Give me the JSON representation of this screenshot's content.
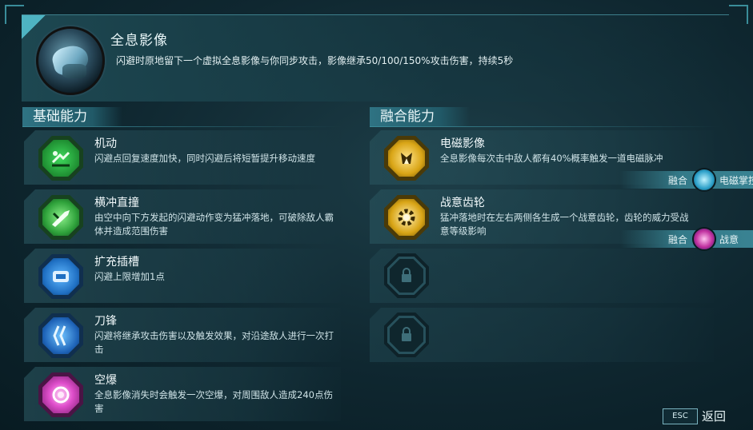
{
  "header": {
    "title": "全息影像",
    "description": "闪避时原地留下一个虚拟全息影像与你同步攻击，影像继承50/100/150%攻击伤害，持续5秒",
    "icon": "hologram-hand-icon"
  },
  "basic": {
    "heading": "基础能力",
    "items": [
      {
        "title": "机动",
        "desc": "闪避点回复速度加快，同时闪避后将短暂提升移动速度",
        "icon": "mobility-icon",
        "color": "#3fcf5a"
      },
      {
        "title": "横冲直撞",
        "desc": "由空中向下方发起的闪避动作变为猛冲落地，可破除敌人霸体并造成范围伤害",
        "icon": "dash-strike-icon",
        "color": "#3fcf5a"
      },
      {
        "title": "扩充插槽",
        "desc": "闪避上限增加1点",
        "icon": "slot-expand-icon",
        "color": "#2f8fe0"
      },
      {
        "title": "刀锋",
        "desc": "闪避将继承攻击伤害以及触发效果，对沿途敌人进行一次打击",
        "icon": "blade-icon",
        "color": "#2f8fe0"
      },
      {
        "title": "空爆",
        "desc": "全息影像消失时会触发一次空爆，对周围敌人造成240点伤害",
        "icon": "air-burst-icon",
        "color": "#e043c8"
      }
    ]
  },
  "fusion": {
    "heading": "融合能力",
    "items": [
      {
        "title": "电磁影像",
        "desc": "全息影像每次击中敌人都有40%概率触发一道电磁脉冲",
        "icon": "electro-image-icon",
        "color": "#e0b51f",
        "fusion_label": "融合",
        "fusion_name": "电磁掌控",
        "fusion_icon": "electro-control-icon"
      },
      {
        "title": "战意齿轮",
        "desc": "猛冲落地时在左右两侧各生成一个战意齿轮，齿轮的威力受战意等级影响",
        "icon": "battle-gear-icon",
        "color": "#e0b51f",
        "fusion_label": "融合",
        "fusion_name": "战意",
        "fusion_icon": "battle-will-icon"
      }
    ],
    "locked": [
      {
        "icon": "lock-icon"
      },
      {
        "icon": "lock-icon"
      }
    ]
  },
  "footer": {
    "esc_key": "ESC",
    "back_label": "返回"
  }
}
